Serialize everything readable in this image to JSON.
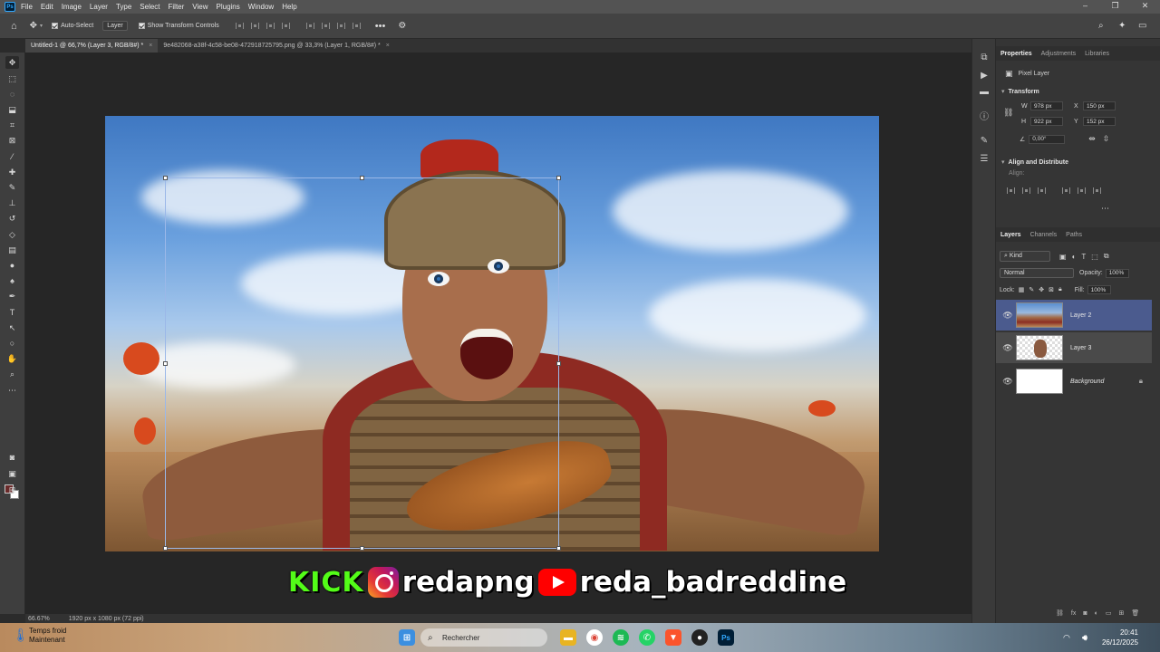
{
  "app": {
    "logo": "Ps",
    "menus": [
      "File",
      "Edit",
      "Image",
      "Layer",
      "Type",
      "Select",
      "Filter",
      "View",
      "Plugins",
      "Window",
      "Help"
    ]
  },
  "options_bar": {
    "auto_select_label": "Auto-Select",
    "layer_dropdown": "Layer",
    "transform_controls_label": "Show Transform Controls"
  },
  "tabs": [
    {
      "label": "Untitled-1 @ 66,7% (Layer 3, RGB/8#) *",
      "active": true
    },
    {
      "label": "9e482068-a38f-4c58-be08-472918725795.png @ 33,3% (Layer 1, RGB/8#) *",
      "active": false
    }
  ],
  "status": {
    "zoom": "66.67%",
    "doc_info": "1920 px x 1080 px (72 ppi)"
  },
  "overlay": {
    "kick_logo_text": "KICK",
    "instagram_handle": "redapng",
    "youtube_handle": "reda_badreddine"
  },
  "properties_panel": {
    "tabs": [
      "Properties",
      "Adjustments",
      "Libraries"
    ],
    "layer_type": "Pixel Layer",
    "transform_title": "Transform",
    "w_label": "W",
    "w_value": "978 px",
    "h_label": "H",
    "h_value": "922 px",
    "x_label": "X",
    "x_value": "150 px",
    "y_label": "Y",
    "y_value": "152 px",
    "angle_value": "0,00°",
    "align_title": "Align and Distribute",
    "align_label": "Align:"
  },
  "layers_panel": {
    "tabs": [
      "Layers",
      "Channels",
      "Paths"
    ],
    "filter_kind": "Kind",
    "blend_mode": "Normal",
    "opacity_label": "Opacity:",
    "opacity_value": "100%",
    "lock_label": "Lock:",
    "fill_label": "Fill:",
    "fill_value": "100%",
    "layers": [
      {
        "name": "Layer 2",
        "selected": true
      },
      {
        "name": "Layer 3",
        "selected": false
      },
      {
        "name": "Background",
        "selected": false
      }
    ]
  },
  "taskbar": {
    "weather_title": "Temps froid",
    "weather_subtitle": "Maintenant",
    "search_placeholder": "Rechercher",
    "time": "20:41",
    "date": "26/12/2025"
  },
  "colors": {
    "selected_layer": "#4b5b8e",
    "kick_green": "#53fc18",
    "youtube_red": "#ff0000",
    "foreground_swatch": "#6a2a2a"
  }
}
